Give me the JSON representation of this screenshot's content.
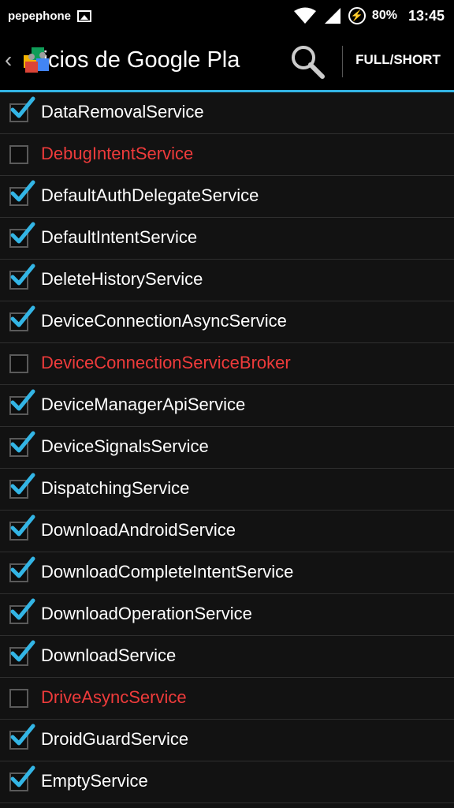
{
  "status": {
    "carrier": "pepephone",
    "battery": "80%",
    "time": "13:45"
  },
  "actionbar": {
    "title": "Servicios de Google Play",
    "visible_title": "vicios de Google Pla",
    "mode_button": "FULL/SHORT"
  },
  "colors": {
    "accent": "#33b5e5",
    "disabled_text": "#ee3b3b",
    "checkmark": "#33b5e5"
  },
  "services": [
    {
      "name": "DataRemovalService",
      "enabled": true
    },
    {
      "name": "DebugIntentService",
      "enabled": false
    },
    {
      "name": "DefaultAuthDelegateService",
      "enabled": true
    },
    {
      "name": "DefaultIntentService",
      "enabled": true
    },
    {
      "name": "DeleteHistoryService",
      "enabled": true
    },
    {
      "name": "DeviceConnectionAsyncService",
      "enabled": true
    },
    {
      "name": "DeviceConnectionServiceBroker",
      "enabled": false
    },
    {
      "name": "DeviceManagerApiService",
      "enabled": true
    },
    {
      "name": "DeviceSignalsService",
      "enabled": true
    },
    {
      "name": "DispatchingService",
      "enabled": true
    },
    {
      "name": "DownloadAndroidService",
      "enabled": true
    },
    {
      "name": "DownloadCompleteIntentService",
      "enabled": true
    },
    {
      "name": "DownloadOperationService",
      "enabled": true
    },
    {
      "name": "DownloadService",
      "enabled": true
    },
    {
      "name": "DriveAsyncService",
      "enabled": false
    },
    {
      "name": "DroidGuardService",
      "enabled": true
    },
    {
      "name": "EmptyService",
      "enabled": true
    }
  ]
}
